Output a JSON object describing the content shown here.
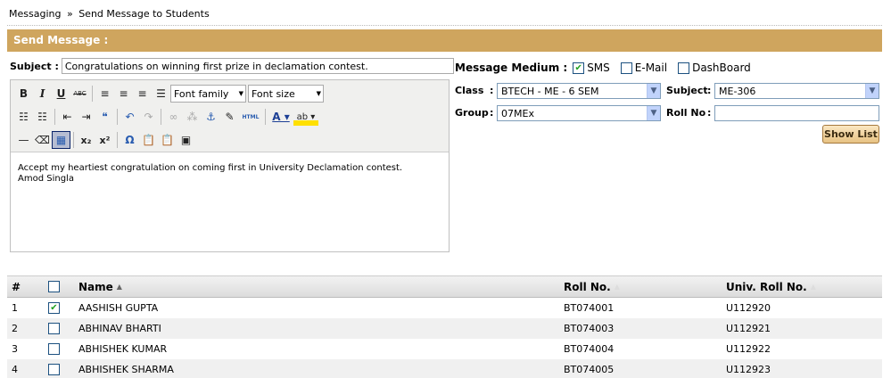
{
  "breadcrumb": {
    "root": "Messaging",
    "separator": "»",
    "current": "Send Message to Students"
  },
  "panel": {
    "title": "Send Message :"
  },
  "subject": {
    "label": "Subject :",
    "value": "Congratulations on winning first prize in declamation contest."
  },
  "editor": {
    "toolbar": {
      "row1": [
        "bold-icon",
        "italic-icon",
        "underline-icon",
        "strikethrough-icon",
        "align-left-icon",
        "align-center-icon",
        "align-right-icon",
        "align-justify-icon"
      ],
      "bold": "B",
      "italic": "I",
      "underline": "U",
      "strike": "ABC",
      "font_family": "Font family",
      "font_size": "Font size",
      "html": "HTML"
    },
    "body_line1": "Accept my heartiest congratulation on coming first in University Declamation contest.",
    "body_line2": "Amod Singla"
  },
  "medium": {
    "label": "Message Medium :",
    "options": [
      {
        "label": "SMS",
        "checked": true
      },
      {
        "label": "E-Mail",
        "checked": false
      },
      {
        "label": "DashBoard",
        "checked": false
      }
    ]
  },
  "filters": {
    "class_label": "Class",
    "class_value": "BTECH - ME - 6 SEM",
    "subject_label": "Subject",
    "subject_value": "ME-306",
    "group_label": "Group",
    "group_value": "07MEx",
    "rollno_label": "Roll No",
    "rollno_value": "",
    "colon": ":"
  },
  "show_list_label": "Show List",
  "grid": {
    "headers": {
      "index": "#",
      "name": "Name",
      "roll": "Roll No.",
      "univ": "Univ. Roll No."
    },
    "rows": [
      {
        "index": "1",
        "checked": true,
        "name": "AASHISH GUPTA",
        "roll": "BT074001",
        "univ": "U112920"
      },
      {
        "index": "2",
        "checked": false,
        "name": "ABHINAV BHARTI",
        "roll": "BT074003",
        "univ": "U112921"
      },
      {
        "index": "3",
        "checked": false,
        "name": "ABHISHEK KUMAR",
        "roll": "BT074004",
        "univ": "U112922"
      },
      {
        "index": "4",
        "checked": false,
        "name": "ABHISHEK SHARMA",
        "roll": "BT074005",
        "univ": "U112923"
      }
    ]
  },
  "colors": {
    "header_bar": "#cfa55e",
    "check_green": "#21a121",
    "dropdown_blue": "#c1d3fb"
  }
}
